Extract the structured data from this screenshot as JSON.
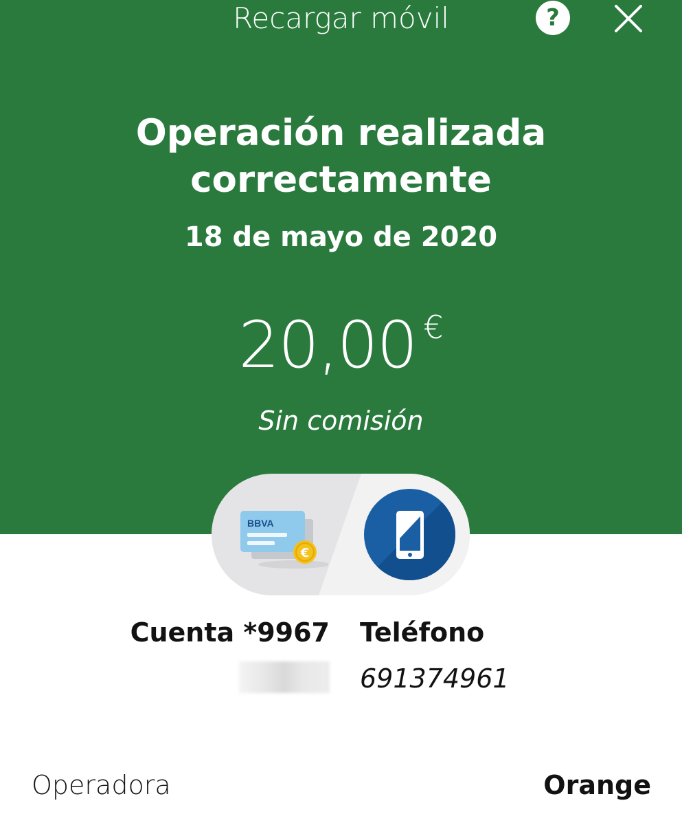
{
  "header": {
    "title": "Recargar móvil",
    "help_icon": "question-mark-icon",
    "help_glyph": "?",
    "close_icon": "close-icon"
  },
  "result": {
    "headline_line1": "Operación realizada",
    "headline_line2": "correctamente",
    "date": "18 de mayo de 2020",
    "amount": "20,00",
    "currency": "€",
    "fee_note": "Sin comisión"
  },
  "transfer_graphic": {
    "card_brand": "BBVA",
    "card_icon": "bank-card-icon",
    "coin_symbol": "€",
    "phone_icon": "mobile-phone-icon"
  },
  "details": {
    "account_label": "Cuenta *9967",
    "phone_label": "Teléfono",
    "phone_number": "691374961",
    "operator_label": "Operadora",
    "operator_value": "Orange"
  },
  "colors": {
    "header_green": "#2a7a3e",
    "phone_circle_blue": "#1a5fa3",
    "card_blue": "#8fc9ec",
    "coin_yellow": "#f4c21c"
  }
}
